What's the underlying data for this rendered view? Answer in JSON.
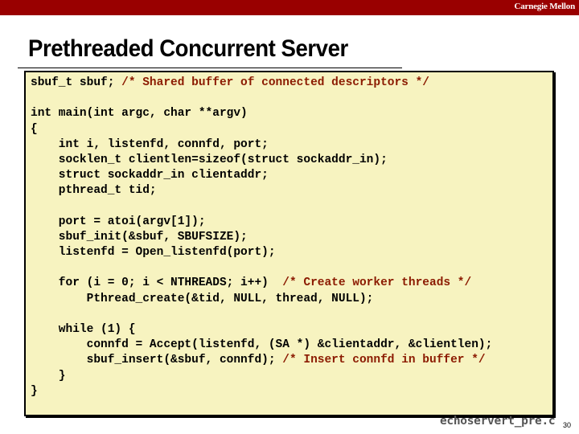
{
  "header": {
    "brand": "Carnegie Mellon",
    "accent_color": "#990000"
  },
  "slide": {
    "title": "Prethreaded Concurrent Server",
    "filename": "echoservert_pre.c",
    "page_number": "30"
  },
  "code": {
    "background_color": "#f7f3c0",
    "comment_color": "#8b1a00",
    "lines": [
      {
        "code": "sbuf_t sbuf; ",
        "comment": "/* Shared buffer of connected descriptors */"
      },
      {
        "code": "",
        "comment": ""
      },
      {
        "code": "int main(int argc, char **argv)",
        "comment": ""
      },
      {
        "code": "{",
        "comment": ""
      },
      {
        "code": "    int i, listenfd, connfd, port;",
        "comment": ""
      },
      {
        "code": "    socklen_t clientlen=sizeof(struct sockaddr_in);",
        "comment": ""
      },
      {
        "code": "    struct sockaddr_in clientaddr;",
        "comment": ""
      },
      {
        "code": "    pthread_t tid;",
        "comment": ""
      },
      {
        "code": "",
        "comment": ""
      },
      {
        "code": "    port = atoi(argv[1]);",
        "comment": ""
      },
      {
        "code": "    sbuf_init(&sbuf, SBUFSIZE);",
        "comment": ""
      },
      {
        "code": "    listenfd = Open_listenfd(port);",
        "comment": ""
      },
      {
        "code": "",
        "comment": ""
      },
      {
        "code": "    for (i = 0; i < NTHREADS; i++)  ",
        "comment": "/* Create worker threads */"
      },
      {
        "code": "        Pthread_create(&tid, NULL, thread, NULL);",
        "comment": ""
      },
      {
        "code": "",
        "comment": ""
      },
      {
        "code": "    while (1) {",
        "comment": ""
      },
      {
        "code": "        connfd = Accept(listenfd, (SA *) &clientaddr, &clientlen);",
        "comment": ""
      },
      {
        "code": "        sbuf_insert(&sbuf, connfd); ",
        "comment": "/* Insert connfd in buffer */"
      },
      {
        "code": "    }",
        "comment": ""
      },
      {
        "code": "}",
        "comment": ""
      }
    ]
  }
}
